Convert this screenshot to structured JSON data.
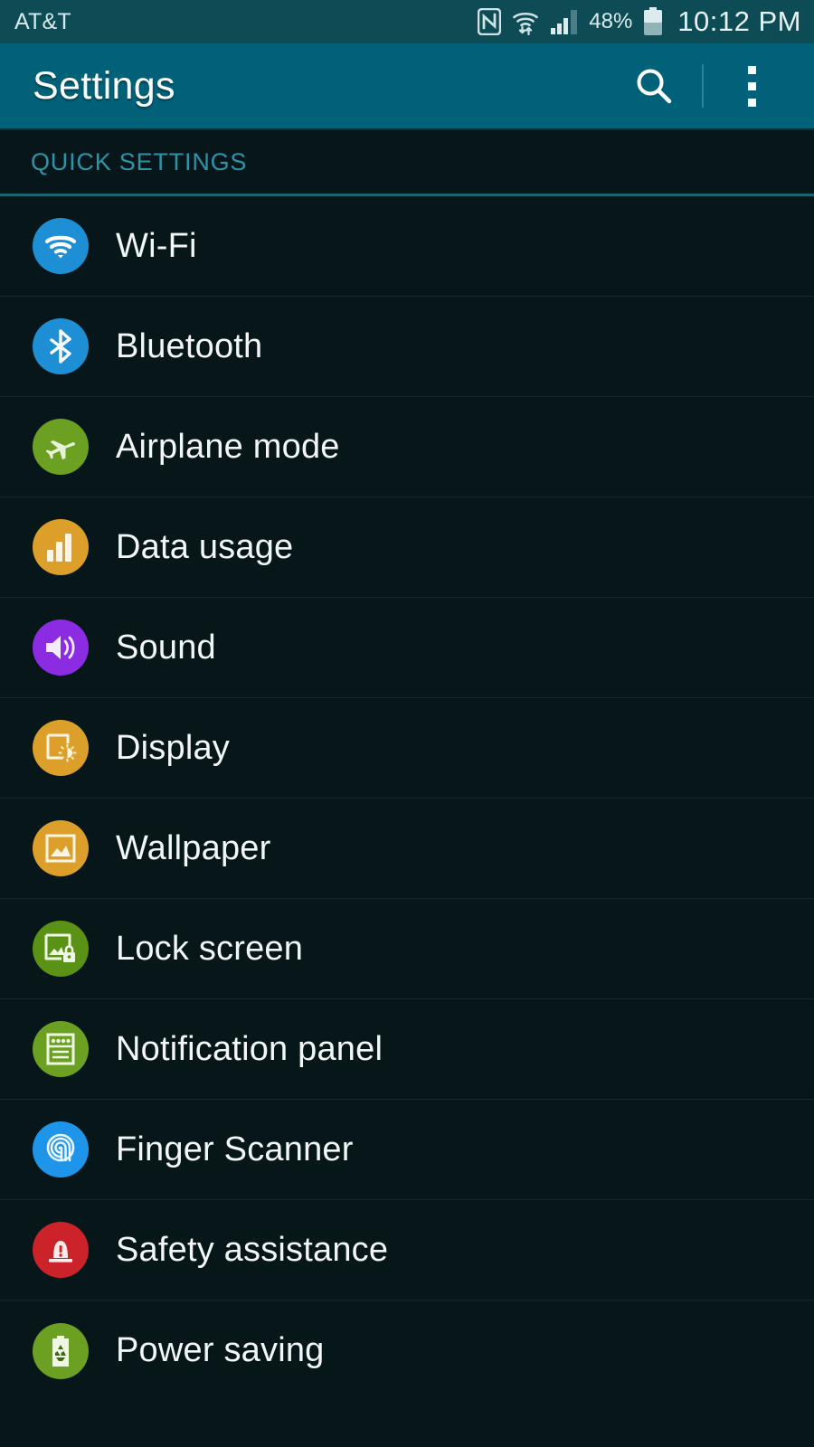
{
  "status_bar": {
    "carrier": "AT&T",
    "battery_percent": "48%",
    "clock": "10:12 PM",
    "icons": [
      "nfc-icon",
      "wifi-transfer-icon",
      "cellular-signal-icon",
      "battery-icon"
    ],
    "background_color": "#0d4c55"
  },
  "action_bar": {
    "title": "Settings",
    "search_icon": "search-icon",
    "overflow_icon": "overflow-menu-icon",
    "background_color": "#016179"
  },
  "section": {
    "header": "QUICK SETTINGS",
    "header_color": "#2f93a8"
  },
  "list": {
    "items": [
      {
        "label": "Wi-Fi",
        "icon": "wifi-icon",
        "color": "#1e8fd5"
      },
      {
        "label": "Bluetooth",
        "icon": "bluetooth-icon",
        "color": "#1e8fd5"
      },
      {
        "label": "Airplane mode",
        "icon": "airplane-icon",
        "color": "#6ba023"
      },
      {
        "label": "Data usage",
        "icon": "data-usage-icon",
        "color": "#dca02a"
      },
      {
        "label": "Sound",
        "icon": "sound-icon",
        "color": "#8b2be2"
      },
      {
        "label": "Display",
        "icon": "display-icon",
        "color": "#dca02a"
      },
      {
        "label": "Wallpaper",
        "icon": "wallpaper-icon",
        "color": "#dca02a"
      },
      {
        "label": "Lock screen",
        "icon": "lock-screen-icon",
        "color": "#5a9216"
      },
      {
        "label": "Notification panel",
        "icon": "notification-panel-icon",
        "color": "#6ba023"
      },
      {
        "label": "Finger Scanner",
        "icon": "fingerprint-icon",
        "color": "#1e95e8"
      },
      {
        "label": "Safety assistance",
        "icon": "safety-siren-icon",
        "color": "#cc2229"
      },
      {
        "label": "Power saving",
        "icon": "power-saving-icon",
        "color": "#6ba023"
      }
    ]
  },
  "theme": {
    "page_background": "#061619",
    "divider_color": "#16282c",
    "label_color": "#f2f6f7"
  }
}
